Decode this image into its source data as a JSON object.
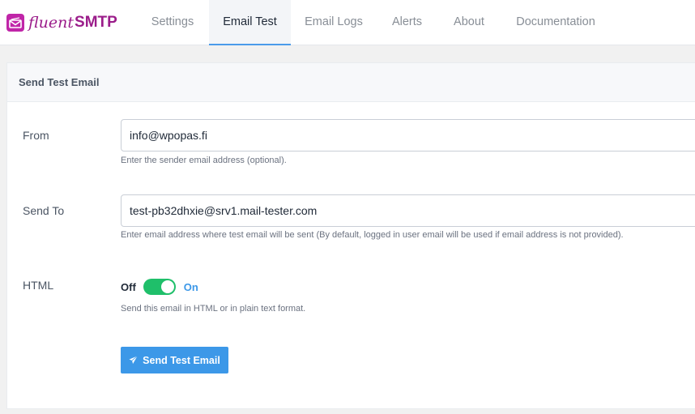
{
  "brand": {
    "logo_text_italic": "fluent",
    "logo_text_bold": "SMTP",
    "color": "#9b1d8a"
  },
  "nav": {
    "tabs": [
      {
        "label": "Settings",
        "active": false
      },
      {
        "label": "Email Test",
        "active": true
      },
      {
        "label": "Email Logs",
        "active": false
      },
      {
        "label": "Alerts",
        "active": false
      },
      {
        "label": "About",
        "active": false
      },
      {
        "label": "Documentation",
        "active": false
      }
    ]
  },
  "card": {
    "title": "Send Test Email"
  },
  "form": {
    "from": {
      "label": "From",
      "value": "info@wpopas.fi",
      "help": "Enter the sender email address (optional)."
    },
    "send_to": {
      "label": "Send To",
      "value": "test-pb32dhxie@srv1.mail-tester.com",
      "help": "Enter email address where test email will be sent (By default, logged in user email will be used if email address is not provided)."
    },
    "html": {
      "label": "HTML",
      "off_label": "Off",
      "on_label": "On",
      "enabled": true,
      "help": "Send this email in HTML or in plain text format."
    },
    "submit_label": "Send Test Email"
  },
  "colors": {
    "accent": "#3c98e8",
    "toggle_on": "#1fbf6a"
  },
  "icons": {
    "logo": "envelope-icon",
    "submit": "paper-plane-icon"
  }
}
